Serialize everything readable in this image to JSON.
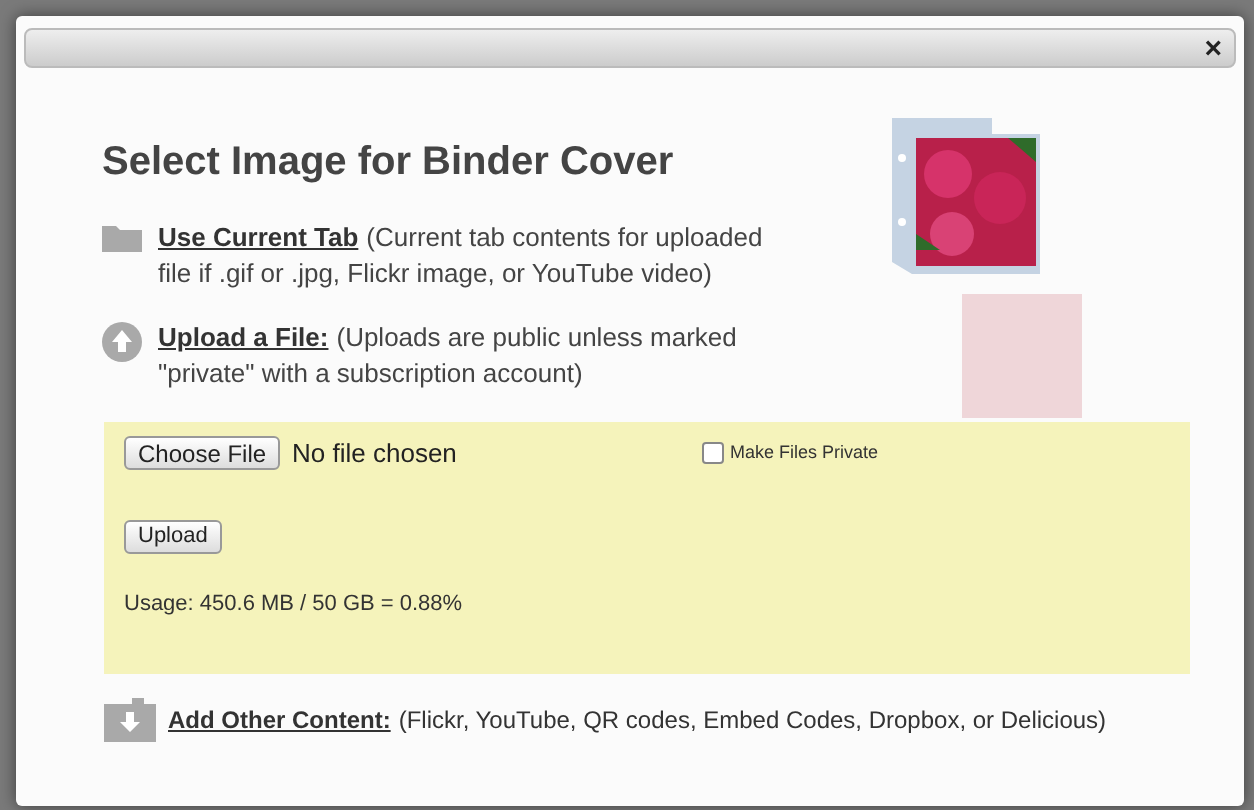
{
  "dialog": {
    "close": "×",
    "heading": "Select Image for Binder Cover"
  },
  "sources": [
    {
      "kind": "folder",
      "link": "Use Current Tab",
      "note": "(Current tab contents for uploaded file if .gif or .jpg, Flickr image, or YouTube video)"
    },
    {
      "kind": "upload",
      "link": "Upload a File:",
      "note": "(Uploads are public unless marked \"private\" with a subscription account)"
    }
  ],
  "upload_panel": {
    "choose_button": "Choose File",
    "file_status": "No file chosen",
    "private_checkbox": {
      "label": "Make Files Private",
      "checked": false
    },
    "upload_button": "Upload",
    "usage": "Usage: 450.6 MB / 50 GB = 0.88%"
  },
  "other_content": {
    "link": "Add Other Content:",
    "note": "(Flickr, YouTube, QR codes, Embed Codes, Dropbox, or Delicious)"
  }
}
